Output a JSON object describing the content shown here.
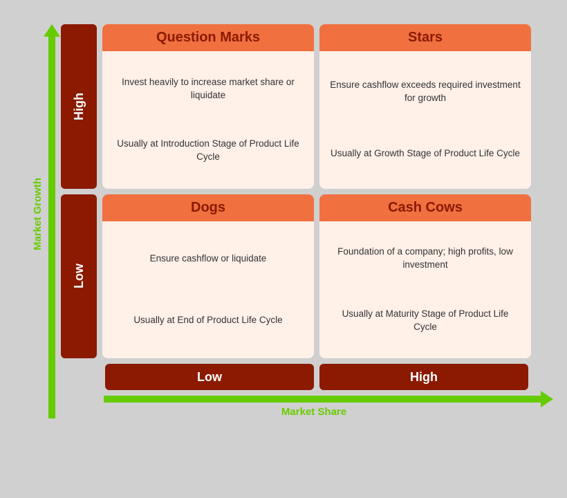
{
  "yAxis": {
    "label": "Market Growth",
    "highLabel": "High",
    "lowLabel": "Low"
  },
  "xAxis": {
    "label": "Market Share",
    "lowLabel": "Low",
    "highLabel": "High"
  },
  "cells": {
    "questionMarks": {
      "title": "Question Marks",
      "line1": "Invest heavily to increase market share or liquidate",
      "line2": "Usually at Introduction Stage of Product Life Cycle"
    },
    "stars": {
      "title": "Stars",
      "line1": "Ensure cashflow exceeds required investment for growth",
      "line2": "Usually at Growth Stage of Product Life Cycle"
    },
    "dogs": {
      "title": "Dogs",
      "line1": "Ensure cashflow or liquidate",
      "line2": "Usually at End of Product Life Cycle"
    },
    "cashCows": {
      "title": "Cash Cows",
      "line1": "Foundation of a company; high profits, low investment",
      "line2": "Usually at Maturity Stage of Product Life Cycle"
    }
  }
}
